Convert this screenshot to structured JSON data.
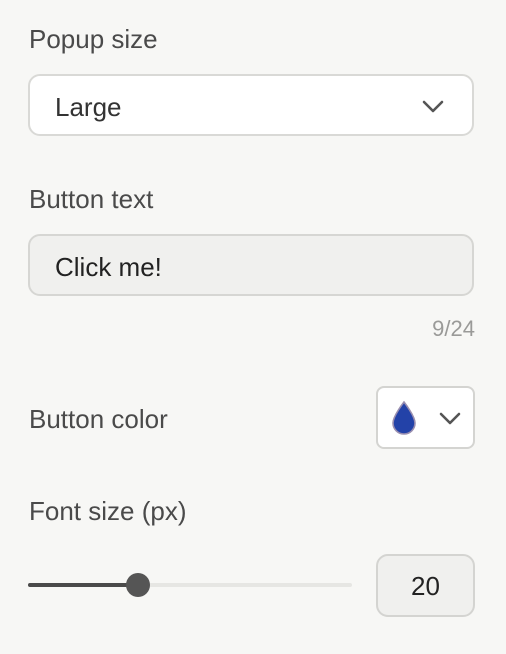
{
  "popup_size": {
    "label": "Popup size",
    "selected": "Large",
    "icon": "chevron-down-icon"
  },
  "button_text": {
    "label": "Button text",
    "value": "Click me!",
    "counter": "9/24"
  },
  "button_color": {
    "label": "Button color",
    "swatch_color": "#2342a8",
    "icon": "color-drop-icon"
  },
  "font_size": {
    "label": "Font size (px)",
    "value": "20",
    "slider_fraction": 0.34
  },
  "colors": {
    "background": "#f7f7f5",
    "slider_fill": "#4a4a4a"
  }
}
